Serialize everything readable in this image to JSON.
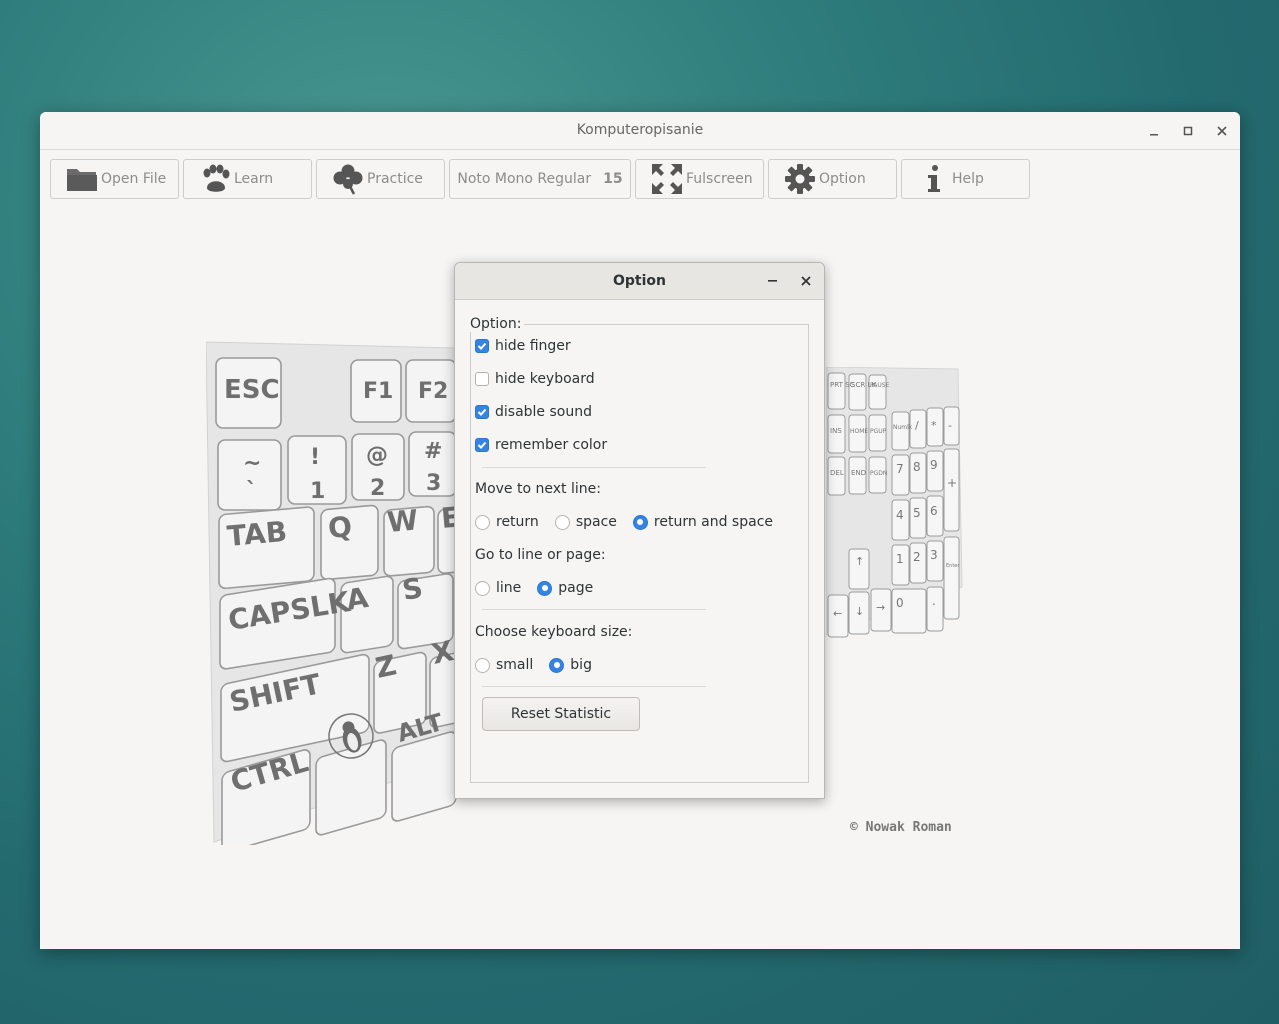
{
  "window": {
    "title": "Komputeropisanie"
  },
  "toolbar": {
    "open_file": {
      "label": "Open File",
      "icon": "folder-icon"
    },
    "learn": {
      "label": "Learn",
      "icon": "paw-icon"
    },
    "practice": {
      "label": "Practice",
      "icon": "clover-icon"
    },
    "font": {
      "name": "Noto Mono Regular",
      "size": "15"
    },
    "fullscreen": {
      "label": "Fulscreen",
      "icon": "fullscreen-icon"
    },
    "option": {
      "label": "Option",
      "icon": "gear-icon"
    },
    "help": {
      "label": "Help",
      "icon": "info-icon"
    }
  },
  "keyboard_left": {
    "keys": [
      "ESC",
      "F1",
      "F2",
      "~",
      "`",
      "!",
      "1",
      "@",
      "2",
      "#",
      "3",
      "TAB",
      "Q",
      "W",
      "E",
      "CAPSLK",
      "A",
      "S",
      "SHIFT",
      "Z",
      "X",
      "CTRL",
      "ALT"
    ]
  },
  "keyboard_right": {
    "keys": [
      "PRT SC",
      "SCR LK",
      "PAUSE",
      "INS",
      "HOME",
      "PGUP",
      "DEL",
      "END",
      "PGDN",
      "Numlk",
      "/",
      "*",
      "-",
      "7",
      "8",
      "9",
      "+",
      "4",
      "5",
      "6",
      "1",
      "2",
      "3",
      "Enter",
      "0",
      ".",
      "↑",
      "←",
      "↓",
      "→"
    ]
  },
  "copyright": "© Nowak Roman",
  "dialog": {
    "title": "Option",
    "frame_label": "Option:",
    "checkboxes": [
      {
        "label": "hide finger",
        "checked": true
      },
      {
        "label": "hide keyboard",
        "checked": false
      },
      {
        "label": "disable sound",
        "checked": true
      },
      {
        "label": "remember color",
        "checked": true
      }
    ],
    "move_next_line": {
      "label": "Move to next line:",
      "options": [
        "return",
        "space",
        "return and space"
      ],
      "selected": "return and space"
    },
    "go_to": {
      "label": "Go to line or page:",
      "options": [
        "line",
        "page"
      ],
      "selected": "page"
    },
    "keyboard_size": {
      "label": "Choose keyboard size:",
      "options": [
        "small",
        "big"
      ],
      "selected": "big"
    },
    "reset_label": "Reset Statistic"
  },
  "colors": {
    "accent": "#3584e4",
    "desktop": "#2f7d7c"
  }
}
